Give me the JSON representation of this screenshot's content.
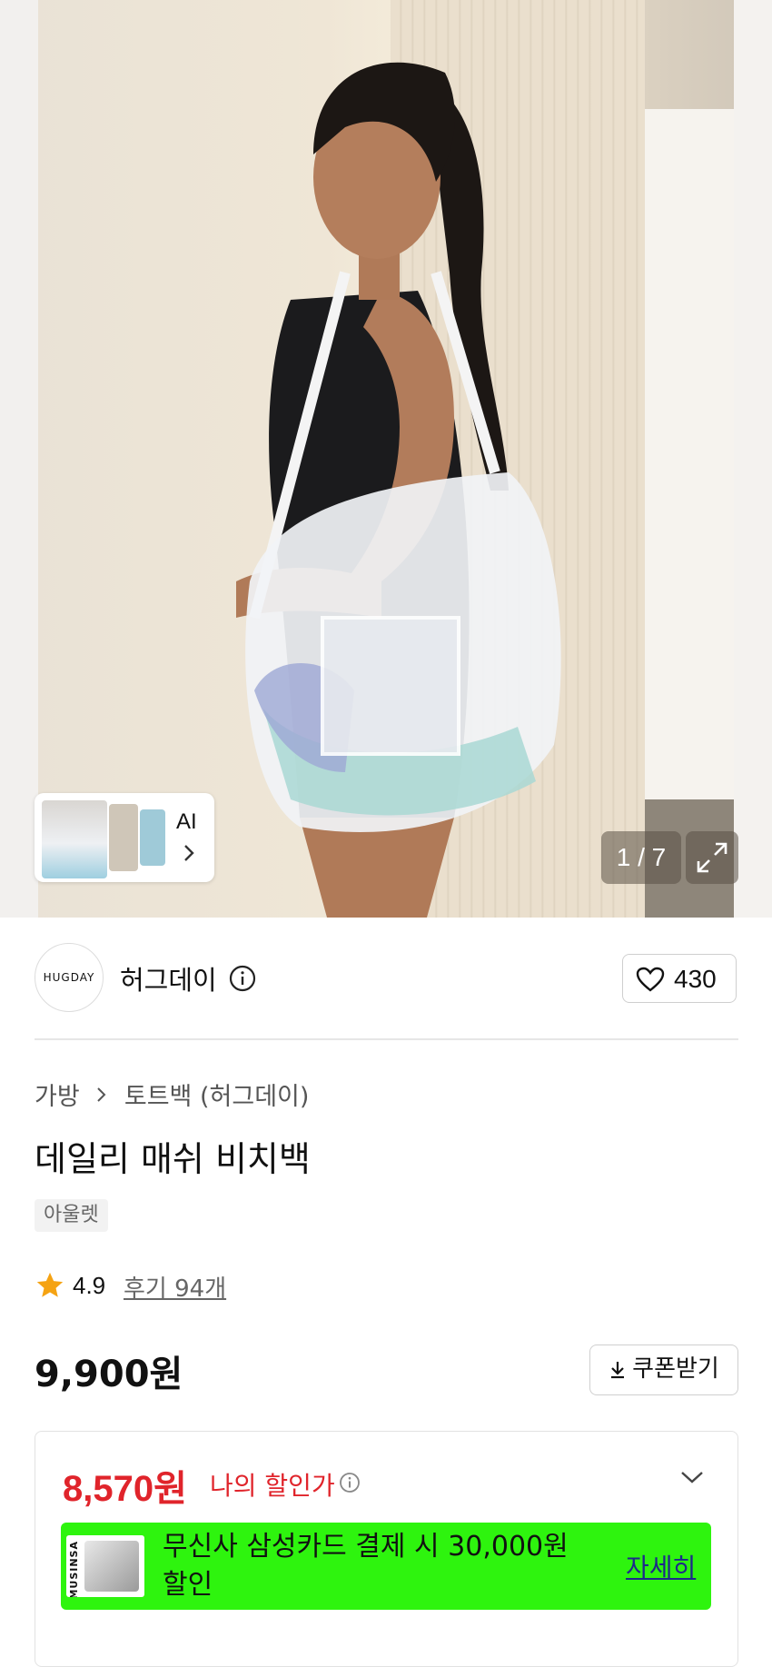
{
  "gallery": {
    "thumbnail_label": "AI",
    "counter": "1 / 7"
  },
  "brand": {
    "logo_text": "HUGDAY",
    "name": "허그데이",
    "likes": "430"
  },
  "breadcrumb": {
    "category": "가방",
    "subcategory": "토트백 (허그데이)"
  },
  "product": {
    "title": "데일리 매쉬 비치백",
    "tag": "아울렛",
    "rating": "4.9",
    "reviews": "후기 94개",
    "price": "9,900원",
    "coupon_button": "쿠폰받기"
  },
  "discount": {
    "price": "8,570원",
    "label": "나의 할인가",
    "promo_text": "무신사 삼성카드 결제 시 30,000원 할인",
    "promo_link": "자세히",
    "card_label": "MUSINSA"
  },
  "colors": {
    "accent_red": "#e0242b",
    "promo_green": "#2ef40e"
  }
}
